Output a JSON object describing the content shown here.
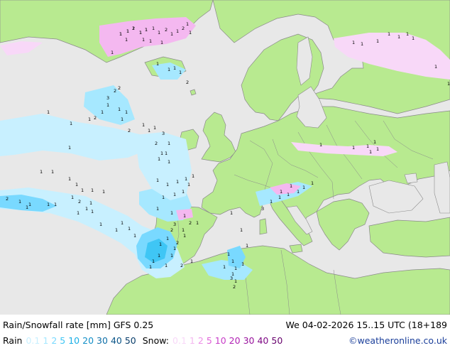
{
  "header": {
    "title": "Rain/Snowfall rate [mm] GFS 0.25",
    "datetime": "We 04-02-2026 15..15 UTC (18+189"
  },
  "legend": {
    "rain_label": "Rain",
    "rain_values": [
      "0.1",
      "1",
      "2",
      "5",
      "10",
      "20",
      "30",
      "40",
      "50"
    ],
    "rain_colors": [
      "#c8f0ff",
      "#a6e8ff",
      "#79d9ff",
      "#3fc6f5",
      "#18aee6",
      "#128fc8",
      "#0e6fa8",
      "#0a5588",
      "#083d6a"
    ],
    "snow_label": "Snow:",
    "snow_values": [
      "0.1",
      "1",
      "2",
      "5",
      "10",
      "20",
      "30",
      "40",
      "50"
    ],
    "snow_colors": [
      "#f8d8f8",
      "#f4b8f0",
      "#ee90e8",
      "#e060d8",
      "#c83cc8",
      "#b020b4",
      "#98109c",
      "#7e0884",
      "#66006c"
    ],
    "credit": "©weatheronline.co.uk"
  },
  "map": {
    "land_color": "#b8ea90",
    "sea_color": "#e8e8e8",
    "border_color": "#8a8a8a",
    "marker_values": [
      "1",
      "1",
      "2",
      "1",
      "1",
      "1",
      "1",
      "2",
      "1",
      "1",
      "2",
      "1",
      "1",
      "1",
      "1",
      "1",
      "1",
      "1",
      "1",
      "1",
      "1",
      "1",
      "2",
      "1",
      "1",
      "1",
      "1",
      "1",
      "1",
      "1",
      "1",
      "1",
      "2",
      "3",
      "2",
      "2",
      "1",
      "1",
      "1",
      "1",
      "1",
      "1",
      "1",
      "1",
      "2",
      "1",
      "1",
      "1",
      "3",
      "1",
      "2",
      "1",
      "1",
      "1",
      "1",
      "1",
      "1",
      "1",
      "1",
      "1",
      "1",
      "1",
      "1",
      "1",
      "2",
      "1",
      "1",
      "2",
      "1",
      "1",
      "1",
      "1",
      "1",
      "1",
      "1",
      "1",
      "1",
      "1",
      "1",
      "1",
      "1",
      "1",
      "1",
      "1",
      "1",
      "1",
      "1",
      "1",
      "1",
      "1",
      "1",
      "1",
      "2",
      "3",
      "2",
      "1",
      "1",
      "2",
      "1",
      "1",
      "1",
      "1",
      "1",
      "1",
      "1",
      "1",
      "2",
      "1",
      "1",
      "1",
      "1",
      "1",
      "1",
      "1",
      "1",
      "1",
      "1",
      "1",
      "3",
      "1",
      "2",
      "3",
      "1",
      "1",
      "1",
      "1",
      "1",
      "1",
      "1",
      "1",
      "1",
      "1",
      "1",
      "1",
      "1",
      "1",
      "1",
      "1",
      "1",
      "1",
      "1"
    ]
  }
}
